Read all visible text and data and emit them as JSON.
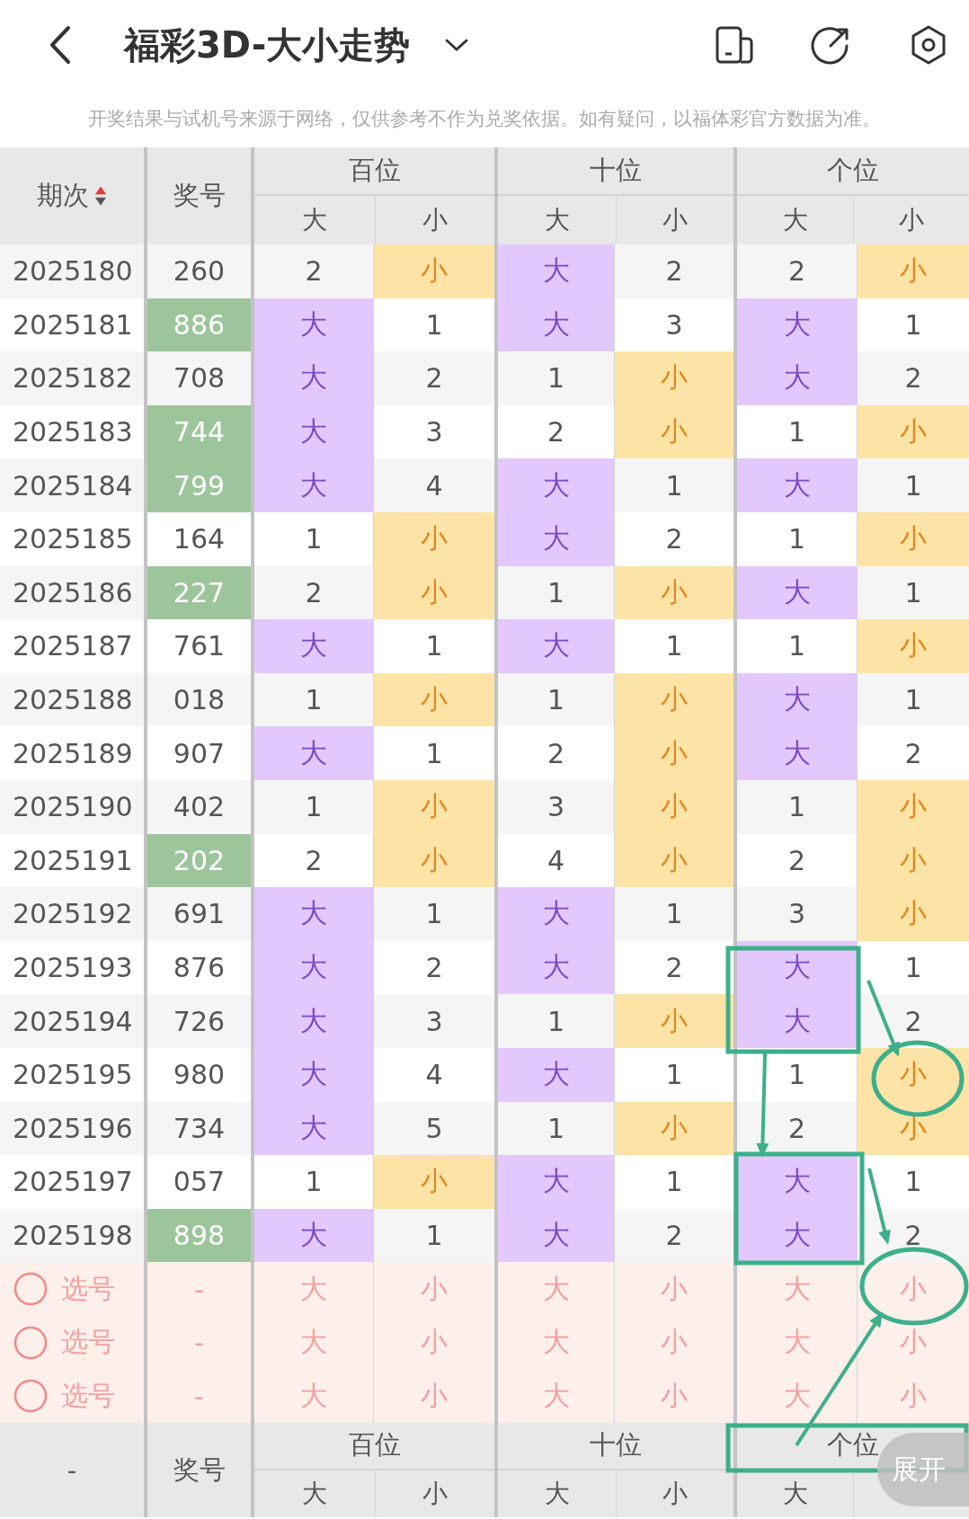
{
  "header": {
    "title": "福彩3D-大小走势"
  },
  "notice": "开奖结果与试机号来源于网络，仅供参考不作为兑奖依据。如有疑问，以福体彩官方数据为准。",
  "table": {
    "columns": [
      {
        "label": "期次"
      },
      {
        "label": "奖号"
      }
    ],
    "groups": [
      {
        "label": "百位",
        "sub": [
          "大",
          "小"
        ]
      },
      {
        "label": "十位",
        "sub": [
          "大",
          "小"
        ]
      },
      {
        "label": "个位",
        "sub": [
          "大",
          "小"
        ]
      }
    ],
    "rows": [
      {
        "period": "2025180",
        "number": "260",
        "highlighted": false,
        "cells": [
          {
            "kind": "count",
            "text": "2"
          },
          {
            "kind": "small",
            "text": "小"
          },
          {
            "kind": "big",
            "text": "大"
          },
          {
            "kind": "count",
            "text": "2"
          },
          {
            "kind": "count",
            "text": "2"
          },
          {
            "kind": "small",
            "text": "小"
          }
        ]
      },
      {
        "period": "2025181",
        "number": "886",
        "highlighted": true,
        "cells": [
          {
            "kind": "big",
            "text": "大"
          },
          {
            "kind": "count",
            "text": "1"
          },
          {
            "kind": "big",
            "text": "大"
          },
          {
            "kind": "count",
            "text": "3"
          },
          {
            "kind": "big",
            "text": "大"
          },
          {
            "kind": "count",
            "text": "1"
          }
        ]
      },
      {
        "period": "2025182",
        "number": "708",
        "highlighted": false,
        "cells": [
          {
            "kind": "big",
            "text": "大"
          },
          {
            "kind": "count",
            "text": "2"
          },
          {
            "kind": "count",
            "text": "1"
          },
          {
            "kind": "small",
            "text": "小"
          },
          {
            "kind": "big",
            "text": "大"
          },
          {
            "kind": "count",
            "text": "2"
          }
        ]
      },
      {
        "period": "2025183",
        "number": "744",
        "highlighted": true,
        "cells": [
          {
            "kind": "big",
            "text": "大"
          },
          {
            "kind": "count",
            "text": "3"
          },
          {
            "kind": "count",
            "text": "2"
          },
          {
            "kind": "small",
            "text": "小"
          },
          {
            "kind": "count",
            "text": "1"
          },
          {
            "kind": "small",
            "text": "小"
          }
        ]
      },
      {
        "period": "2025184",
        "number": "799",
        "highlighted": true,
        "cells": [
          {
            "kind": "big",
            "text": "大"
          },
          {
            "kind": "count",
            "text": "4"
          },
          {
            "kind": "big",
            "text": "大"
          },
          {
            "kind": "count",
            "text": "1"
          },
          {
            "kind": "big",
            "text": "大"
          },
          {
            "kind": "count",
            "text": "1"
          }
        ]
      },
      {
        "period": "2025185",
        "number": "164",
        "highlighted": false,
        "cells": [
          {
            "kind": "count",
            "text": "1"
          },
          {
            "kind": "small",
            "text": "小"
          },
          {
            "kind": "big",
            "text": "大"
          },
          {
            "kind": "count",
            "text": "2"
          },
          {
            "kind": "count",
            "text": "1"
          },
          {
            "kind": "small",
            "text": "小"
          }
        ]
      },
      {
        "period": "2025186",
        "number": "227",
        "highlighted": true,
        "cells": [
          {
            "kind": "count",
            "text": "2"
          },
          {
            "kind": "small",
            "text": "小"
          },
          {
            "kind": "count",
            "text": "1"
          },
          {
            "kind": "small",
            "text": "小"
          },
          {
            "kind": "big",
            "text": "大"
          },
          {
            "kind": "count",
            "text": "1"
          }
        ]
      },
      {
        "period": "2025187",
        "number": "761",
        "highlighted": false,
        "cells": [
          {
            "kind": "big",
            "text": "大"
          },
          {
            "kind": "count",
            "text": "1"
          },
          {
            "kind": "big",
            "text": "大"
          },
          {
            "kind": "count",
            "text": "1"
          },
          {
            "kind": "count",
            "text": "1"
          },
          {
            "kind": "small",
            "text": "小"
          }
        ]
      },
      {
        "period": "2025188",
        "number": "018",
        "highlighted": false,
        "cells": [
          {
            "kind": "count",
            "text": "1"
          },
          {
            "kind": "small",
            "text": "小"
          },
          {
            "kind": "count",
            "text": "1"
          },
          {
            "kind": "small",
            "text": "小"
          },
          {
            "kind": "big",
            "text": "大"
          },
          {
            "kind": "count",
            "text": "1"
          }
        ]
      },
      {
        "period": "2025189",
        "number": "907",
        "highlighted": false,
        "cells": [
          {
            "kind": "big",
            "text": "大"
          },
          {
            "kind": "count",
            "text": "1"
          },
          {
            "kind": "count",
            "text": "2"
          },
          {
            "kind": "small",
            "text": "小"
          },
          {
            "kind": "big",
            "text": "大"
          },
          {
            "kind": "count",
            "text": "2"
          }
        ]
      },
      {
        "period": "2025190",
        "number": "402",
        "highlighted": false,
        "cells": [
          {
            "kind": "count",
            "text": "1"
          },
          {
            "kind": "small",
            "text": "小"
          },
          {
            "kind": "count",
            "text": "3"
          },
          {
            "kind": "small",
            "text": "小"
          },
          {
            "kind": "count",
            "text": "1"
          },
          {
            "kind": "small",
            "text": "小"
          }
        ]
      },
      {
        "period": "2025191",
        "number": "202",
        "highlighted": true,
        "cells": [
          {
            "kind": "count",
            "text": "2"
          },
          {
            "kind": "small",
            "text": "小"
          },
          {
            "kind": "count",
            "text": "4"
          },
          {
            "kind": "small",
            "text": "小"
          },
          {
            "kind": "count",
            "text": "2"
          },
          {
            "kind": "small",
            "text": "小"
          }
        ]
      },
      {
        "period": "2025192",
        "number": "691",
        "highlighted": false,
        "cells": [
          {
            "kind": "big",
            "text": "大"
          },
          {
            "kind": "count",
            "text": "1"
          },
          {
            "kind": "big",
            "text": "大"
          },
          {
            "kind": "count",
            "text": "1"
          },
          {
            "kind": "count",
            "text": "3"
          },
          {
            "kind": "small",
            "text": "小"
          }
        ]
      },
      {
        "period": "2025193",
        "number": "876",
        "highlighted": false,
        "cells": [
          {
            "kind": "big",
            "text": "大"
          },
          {
            "kind": "count",
            "text": "2"
          },
          {
            "kind": "big",
            "text": "大"
          },
          {
            "kind": "count",
            "text": "2"
          },
          {
            "kind": "big",
            "text": "大"
          },
          {
            "kind": "count",
            "text": "1"
          }
        ]
      },
      {
        "period": "2025194",
        "number": "726",
        "highlighted": false,
        "cells": [
          {
            "kind": "big",
            "text": "大"
          },
          {
            "kind": "count",
            "text": "3"
          },
          {
            "kind": "count",
            "text": "1"
          },
          {
            "kind": "small",
            "text": "小"
          },
          {
            "kind": "big",
            "text": "大"
          },
          {
            "kind": "count",
            "text": "2"
          }
        ]
      },
      {
        "period": "2025195",
        "number": "980",
        "highlighted": false,
        "cells": [
          {
            "kind": "big",
            "text": "大"
          },
          {
            "kind": "count",
            "text": "4"
          },
          {
            "kind": "big",
            "text": "大"
          },
          {
            "kind": "count",
            "text": "1"
          },
          {
            "kind": "count",
            "text": "1"
          },
          {
            "kind": "small",
            "text": "小"
          }
        ]
      },
      {
        "period": "2025196",
        "number": "734",
        "highlighted": false,
        "cells": [
          {
            "kind": "big",
            "text": "大"
          },
          {
            "kind": "count",
            "text": "5"
          },
          {
            "kind": "count",
            "text": "1"
          },
          {
            "kind": "small",
            "text": "小"
          },
          {
            "kind": "count",
            "text": "2"
          },
          {
            "kind": "small",
            "text": "小"
          }
        ]
      },
      {
        "period": "2025197",
        "number": "057",
        "highlighted": false,
        "cells": [
          {
            "kind": "count",
            "text": "1"
          },
          {
            "kind": "small",
            "text": "小"
          },
          {
            "kind": "big",
            "text": "大"
          },
          {
            "kind": "count",
            "text": "1"
          },
          {
            "kind": "big",
            "text": "大"
          },
          {
            "kind": "count",
            "text": "1"
          }
        ]
      },
      {
        "period": "2025198",
        "number": "898",
        "highlighted": true,
        "cells": [
          {
            "kind": "big",
            "text": "大"
          },
          {
            "kind": "count",
            "text": "1"
          },
          {
            "kind": "big",
            "text": "大"
          },
          {
            "kind": "count",
            "text": "2"
          },
          {
            "kind": "big",
            "text": "大"
          },
          {
            "kind": "count",
            "text": "2"
          }
        ]
      }
    ],
    "pick_rows": [
      {
        "label": "选号",
        "number": "-",
        "options": [
          "大",
          "小",
          "大",
          "小",
          "大",
          "小"
        ]
      },
      {
        "label": "选号",
        "number": "-",
        "options": [
          "大",
          "小",
          "大",
          "小",
          "大",
          "小"
        ]
      },
      {
        "label": "选号",
        "number": "-",
        "options": [
          "大",
          "小",
          "大",
          "小",
          "大",
          "小"
        ]
      }
    ],
    "footer": {
      "period": "-",
      "number": "奖号",
      "groups": [
        "百位",
        "十位",
        "个位"
      ],
      "sub": [
        "大",
        "小",
        "大",
        "小",
        "大"
      ]
    }
  },
  "expand_button": "展开"
}
